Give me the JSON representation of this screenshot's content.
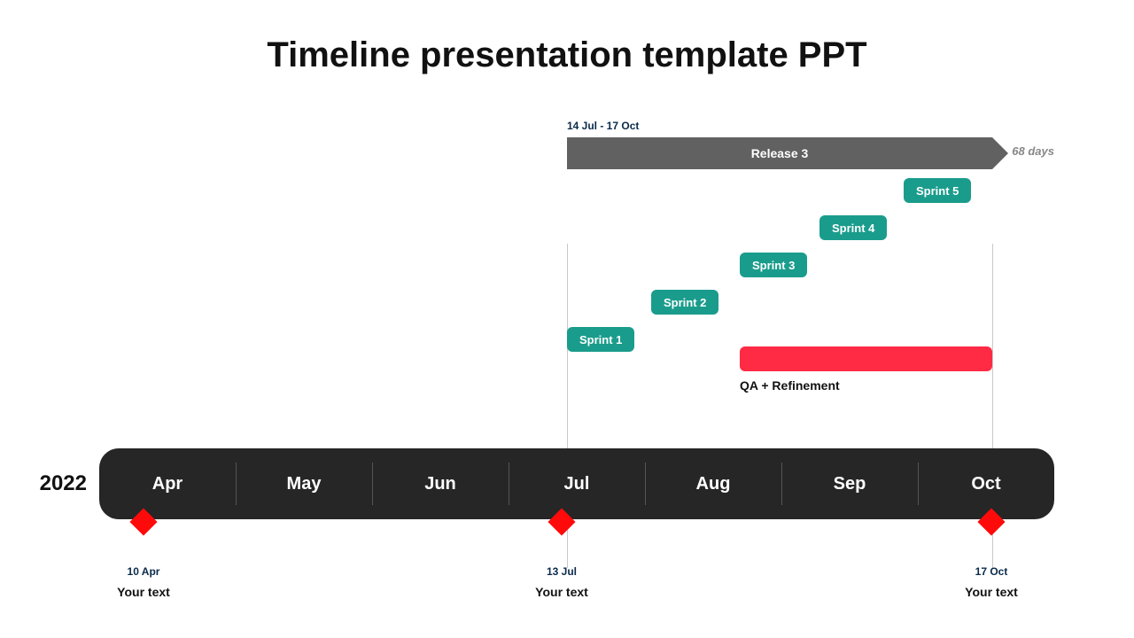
{
  "title": "Timeline presentation template PPT",
  "year": "2022",
  "months": [
    "Apr",
    "May",
    "Jun",
    "Jul",
    "Aug",
    "Sep",
    "Oct"
  ],
  "release": {
    "date_range": "14 Jul - 17 Oct",
    "name": "Release 3",
    "days_label": "68 days"
  },
  "sprints": {
    "s1": "Sprint 1",
    "s2": "Sprint 2",
    "s3": "Sprint 3",
    "s4": "Sprint 4",
    "s5": "Sprint 5"
  },
  "qa_label": "QA + Refinement",
  "milestones": [
    {
      "date": "10 Apr",
      "text": "Your text"
    },
    {
      "date": "13 Jul",
      "text": "Your text"
    },
    {
      "date": "17 Oct",
      "text": "Your text"
    }
  ],
  "chart_data": {
    "type": "gantt-timeline",
    "title": "Timeline presentation template PPT",
    "year": 2022,
    "months": [
      "Apr",
      "May",
      "Jun",
      "Jul",
      "Aug",
      "Sep",
      "Oct"
    ],
    "release": {
      "name": "Release 3",
      "start": "14 Jul",
      "end": "17 Oct",
      "duration_days": 68
    },
    "sprints": [
      {
        "name": "Sprint 1",
        "approx_start": "14 Jul",
        "approx_end": "31 Jul"
      },
      {
        "name": "Sprint 2",
        "approx_start": "01 Aug",
        "approx_end": "18 Aug"
      },
      {
        "name": "Sprint 3",
        "approx_start": "19 Aug",
        "approx_end": "05 Sep"
      },
      {
        "name": "Sprint 4",
        "approx_start": "06 Sep",
        "approx_end": "25 Sep"
      },
      {
        "name": "Sprint 5",
        "approx_start": "26 Sep",
        "approx_end": "17 Oct"
      }
    ],
    "qa_bar": {
      "label": "QA + Refinement",
      "approx_start": "19 Aug",
      "approx_end": "17 Oct"
    },
    "milestones": [
      {
        "date": "10 Apr",
        "label": "Your text"
      },
      {
        "date": "13 Jul",
        "label": "Your text"
      },
      {
        "date": "17 Oct",
        "label": "Your text"
      }
    ]
  }
}
